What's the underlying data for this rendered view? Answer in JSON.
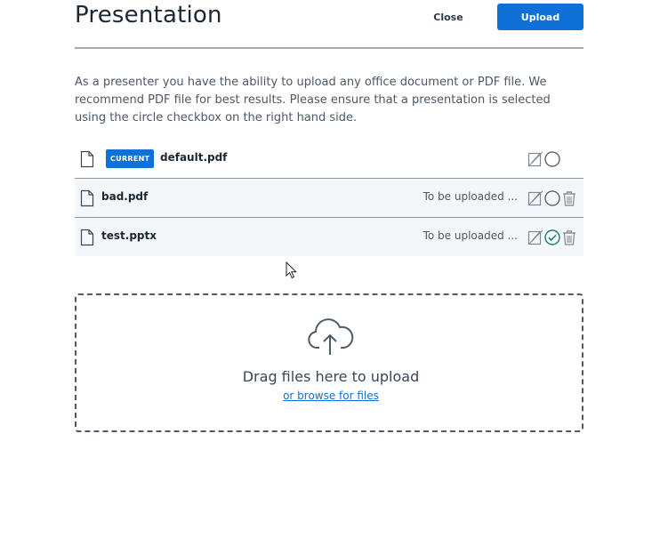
{
  "header": {
    "title": "Presentation",
    "close_label": "Close",
    "upload_label": "Upload"
  },
  "description": "As a presenter you have the ability to upload any office document or PDF file. We recommend PDF file for best results. Please ensure that a presentation is selected using the circle checkbox on the right hand side.",
  "files": [
    {
      "name": "default.pdf",
      "badge": "CURRENT",
      "status": "",
      "selected": false,
      "removable": false
    },
    {
      "name": "bad.pdf",
      "badge": "",
      "status": "To be uploaded ...",
      "selected": false,
      "removable": true
    },
    {
      "name": "test.pptx",
      "badge": "",
      "status": "To be uploaded ...",
      "selected": true,
      "removable": true
    }
  ],
  "dropzone": {
    "text": "Drag files here to upload",
    "browse_label": "or browse for files"
  },
  "colors": {
    "accent": "#0f70d7",
    "selected_check": "#1a7d73",
    "icon_gray": "#7d8894"
  }
}
